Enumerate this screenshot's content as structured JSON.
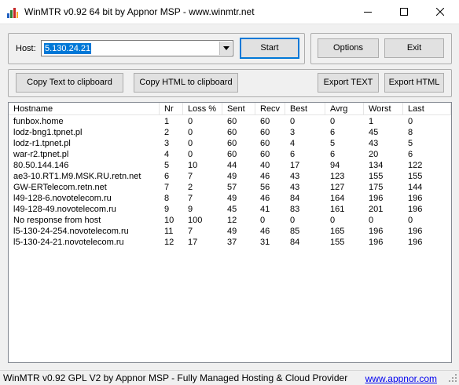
{
  "window": {
    "title": "WinMTR v0.92 64 bit by Appnor MSP - www.winmtr.net"
  },
  "host": {
    "label": "Host:",
    "value": "5.130.24.21"
  },
  "buttons": {
    "start": "Start",
    "options": "Options",
    "exit": "Exit",
    "copy_text": "Copy Text to clipboard",
    "copy_html": "Copy HTML to clipboard",
    "export_text": "Export TEXT",
    "export_html": "Export HTML"
  },
  "table": {
    "columns": [
      "Hostname",
      "Nr",
      "Loss %",
      "Sent",
      "Recv",
      "Best",
      "Avrg",
      "Worst",
      "Last"
    ],
    "rows": [
      [
        "funbox.home",
        "1",
        "0",
        "60",
        "60",
        "0",
        "0",
        "1",
        "0"
      ],
      [
        "lodz-bng1.tpnet.pl",
        "2",
        "0",
        "60",
        "60",
        "3",
        "6",
        "45",
        "8"
      ],
      [
        "lodz-r1.tpnet.pl",
        "3",
        "0",
        "60",
        "60",
        "4",
        "5",
        "43",
        "5"
      ],
      [
        "war-r2.tpnet.pl",
        "4",
        "0",
        "60",
        "60",
        "6",
        "6",
        "20",
        "6"
      ],
      [
        "80.50.144.146",
        "5",
        "10",
        "44",
        "40",
        "17",
        "94",
        "134",
        "122"
      ],
      [
        "ae3-10.RT1.M9.MSK.RU.retn.net",
        "6",
        "7",
        "49",
        "46",
        "43",
        "123",
        "155",
        "155"
      ],
      [
        "GW-ERTelecom.retn.net",
        "7",
        "2",
        "57",
        "56",
        "43",
        "127",
        "175",
        "144"
      ],
      [
        "l49-128-6.novotelecom.ru",
        "8",
        "7",
        "49",
        "46",
        "84",
        "164",
        "196",
        "196"
      ],
      [
        "l49-128-49.novotelecom.ru",
        "9",
        "9",
        "45",
        "41",
        "83",
        "161",
        "201",
        "196"
      ],
      [
        "No response from host",
        "10",
        "100",
        "12",
        "0",
        "0",
        "0",
        "0",
        "0"
      ],
      [
        "l5-130-24-254.novotelecom.ru",
        "11",
        "7",
        "49",
        "46",
        "85",
        "165",
        "196",
        "196"
      ],
      [
        "l5-130-24-21.novotelecom.ru",
        "12",
        "17",
        "37",
        "31",
        "84",
        "155",
        "196",
        "196"
      ]
    ]
  },
  "status": {
    "text": "WinMTR v0.92 GPL V2 by Appnor MSP - Fully Managed Hosting & Cloud Provider",
    "link": "www.appnor.com"
  },
  "colors": {
    "selection": "#0078d7",
    "link": "#0000ee"
  },
  "icons": {
    "app": "chart-bars-icon",
    "minimize": "minimize-icon",
    "maximize": "maximize-icon",
    "close": "close-icon",
    "dropdown": "chevron-down-icon",
    "grip": "resize-grip-icon"
  }
}
